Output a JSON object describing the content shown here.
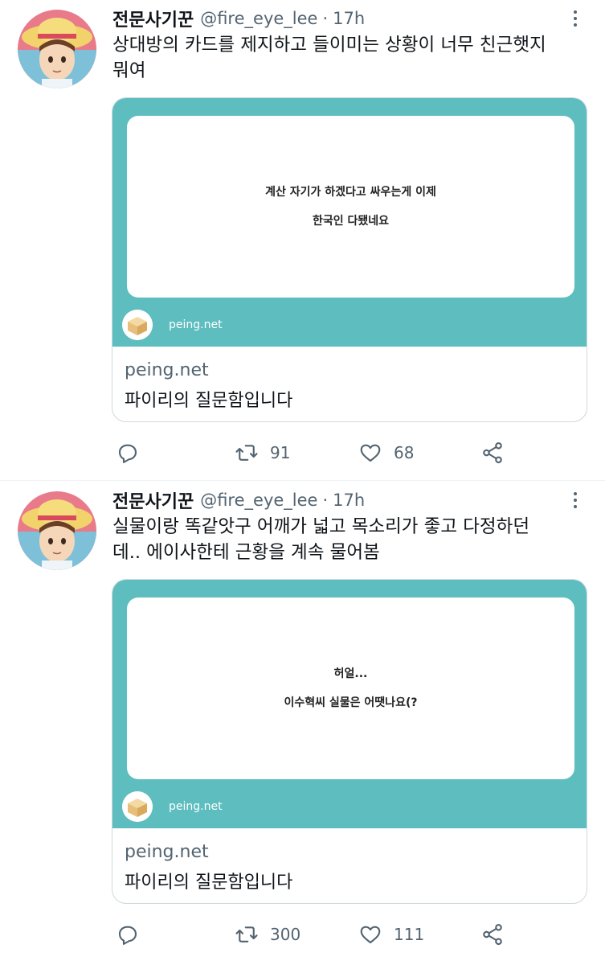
{
  "tweets": [
    {
      "author": "전문사기꾼",
      "handle": "@fire_eye_lee",
      "separator": "·",
      "time": "17h",
      "text_lines": [
        "상대방의 카드를 제지하고 들이미는 상황이 너무 친근햇지",
        "뭐여"
      ],
      "card": {
        "question_lines": [
          "계산 자기가 하겠다고 싸우는게 이제",
          "한국인 다됐네요"
        ],
        "brand": "peing.net",
        "domain": "peing.net",
        "title": "파이리의 질문함입니다"
      },
      "actions": {
        "reply_count": "",
        "retweet_count": "91",
        "like_count": "68"
      }
    },
    {
      "author": "전문사기꾼",
      "handle": "@fire_eye_lee",
      "separator": "·",
      "time": "17h",
      "text_lines": [
        "실물이랑 똑같앗구 어깨가 넓고 목소리가 좋고 다정하던",
        "데.. 에이사한테 근황을 계속 물어봄"
      ],
      "card": {
        "question_lines": [
          "허얼...",
          "이수혁씨 실물은 어땟나요(?"
        ],
        "brand": "peing.net",
        "domain": "peing.net",
        "title": "파이리의 질문함입니다"
      },
      "actions": {
        "reply_count": "",
        "retweet_count": "300",
        "like_count": "111"
      }
    }
  ],
  "icons": {
    "reply": "reply-icon",
    "retweet": "retweet-icon",
    "like": "heart-icon",
    "share": "share-icon",
    "more": "more-icon",
    "brand_logo": "peing-box-icon"
  },
  "colors": {
    "card_teal": "#5ebdbf",
    "secondary_text": "#536471",
    "primary_text": "#0f1419",
    "border": "#cfd9de"
  }
}
